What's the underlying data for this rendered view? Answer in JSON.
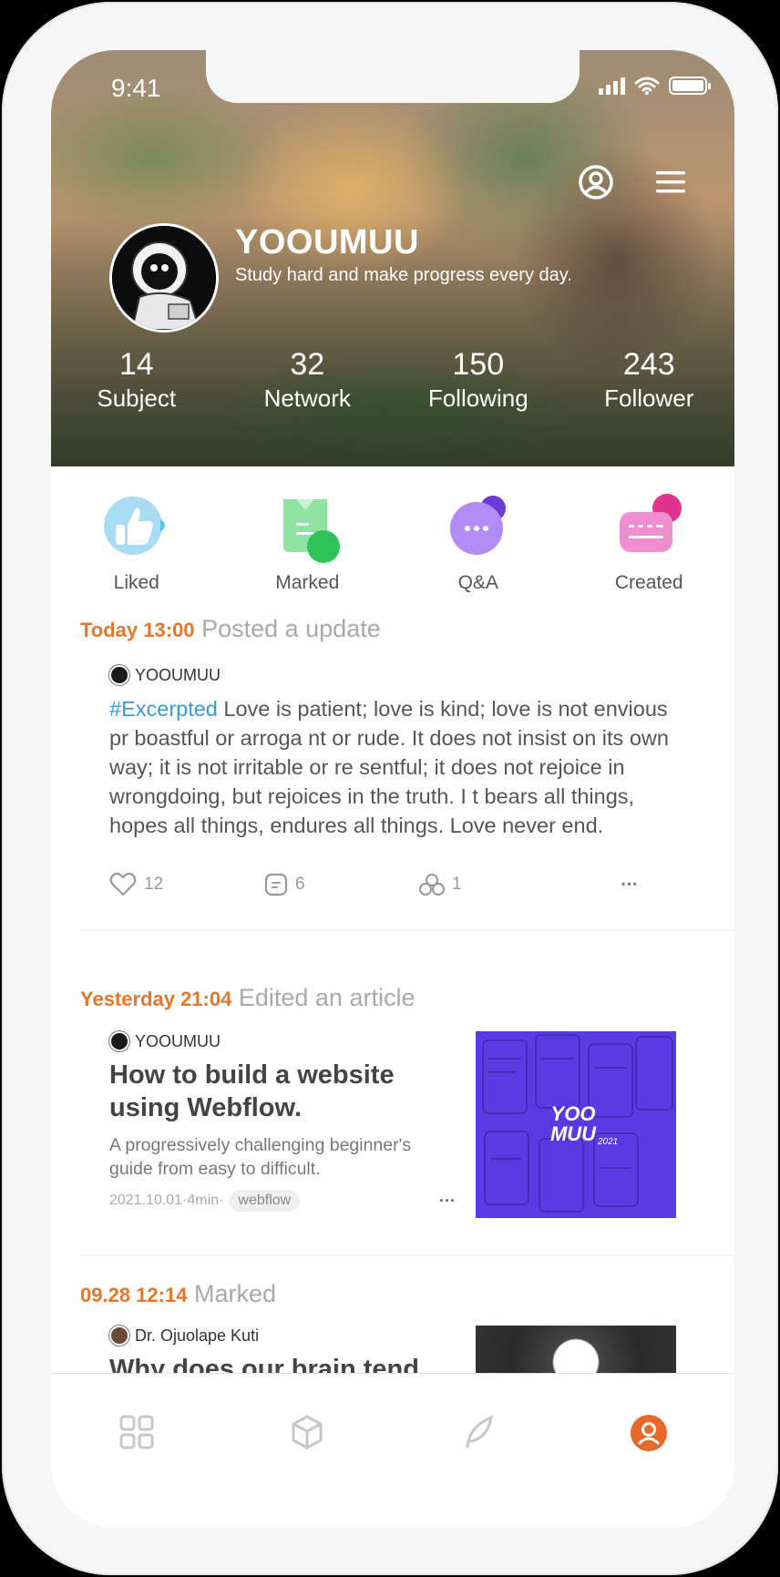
{
  "status_bar": {
    "time": "9:41"
  },
  "profile": {
    "name": "YOOUMUU",
    "bio": "Study hard and make progress every day.",
    "stats": [
      {
        "value": "14",
        "label": "Subject"
      },
      {
        "value": "32",
        "label": "Network"
      },
      {
        "value": "150",
        "label": "Following"
      },
      {
        "value": "243",
        "label": "Follower"
      }
    ]
  },
  "shortcuts": [
    {
      "label": "Liked",
      "icon": "thumbs-up-icon",
      "color": "#5cc0e6"
    },
    {
      "label": "Marked",
      "icon": "bookmark-icon",
      "color": "#4cd36a"
    },
    {
      "label": "Q&A",
      "icon": "chat-bubble-icon",
      "color": "#9a6cf2"
    },
    {
      "label": "Created",
      "icon": "keyboard-message-icon",
      "color": "#e24fa5"
    }
  ],
  "feed": [
    {
      "time": "Today 13:00",
      "action": "Posted a update",
      "author": "YOOUMUU",
      "hashtag": "#Excerpted",
      "text": " Love is patient; love is kind; love is not envious pr boastful or arroga nt or rude. It does not insist on its own way; it is not irritable or re sentful; it does not rejoice in wrongdoing, but rejoices in the truth. I t bears all things, hopes all things, endures all things. Love never end.",
      "likes": "12",
      "comments": "6",
      "shares": "1",
      "more": "···"
    },
    {
      "time": "Yesterday 21:04",
      "action": "Edited an article",
      "author": "YOOUMUU",
      "title": "How to build a website using Webflow.",
      "description": "A progressively challenging beginner's guide from easy to difficult.",
      "meta": "2021.10.01·4min·",
      "tag": "webflow",
      "more": "···",
      "thumbnail_text": "YOO MUU",
      "thumbnail_year": "2021"
    },
    {
      "time": "09.28 12:14",
      "action": "Marked",
      "author": "Dr. Ojuolape Kuti",
      "title": "Why does our brain tend"
    }
  ],
  "tabbar": [
    {
      "icon": "grid-icon",
      "active": false
    },
    {
      "icon": "cube-icon",
      "active": false
    },
    {
      "icon": "feather-icon",
      "active": false
    },
    {
      "icon": "profile-icon",
      "active": true
    }
  ],
  "colors": {
    "accent": "#e5772a",
    "hashtag": "#3a9bd1",
    "muted": "#a9a9a9"
  }
}
